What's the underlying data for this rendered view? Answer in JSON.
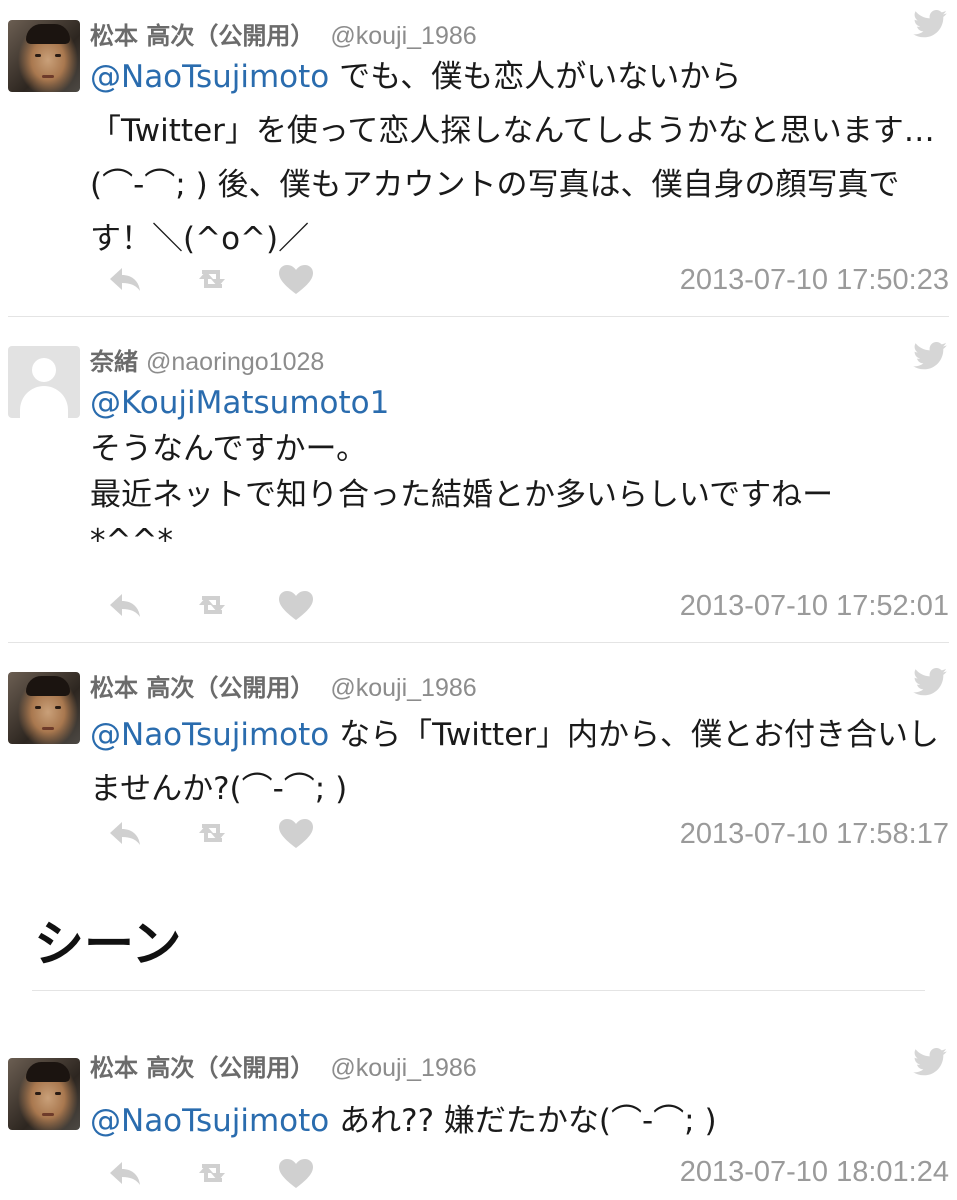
{
  "tweets": [
    {
      "name": "松本 高次（公開用）",
      "handle": "@kouji_1986",
      "mention": "@NaoTsujimoto",
      "body": " でも、僕も恋人がいないから\n「Twitter」を使って恋人探しなんてしようかなと思います…(⌒-⌒; ) 後、僕もアカウントの写真は、僕自身の顔写真です！＼(^o^)／",
      "time": "2013-07-10 17:50:23"
    },
    {
      "name": "奈緒",
      "handle": "@naoringo1028",
      "mention": "@KoujiMatsumoto1",
      "body": "\nそうなんですかー。\n最近ネットで知り合った結婚とか多いらしいですねー\n*^^*",
      "time": "2013-07-10 17:52:01"
    },
    {
      "name": "松本 高次（公開用）",
      "handle": "@kouji_1986",
      "mention": "@NaoTsujimoto",
      "body": " なら「Twitter」内から、僕とお付き合いしませんか?(⌒-⌒; )",
      "time": "2013-07-10 17:58:17"
    },
    {
      "name": "松本 高次（公開用）",
      "handle": "@kouji_1986",
      "mention": "@NaoTsujimoto",
      "body": " あれ?? 嫌だたかな(⌒-⌒; )",
      "time": "2013-07-10 18:01:24"
    }
  ],
  "scene_caption": "シーン",
  "icons": {
    "reply": "reply-icon",
    "retweet": "retweet-icon",
    "like": "heart-icon",
    "logo": "twitter-bird-icon"
  },
  "colors": {
    "mention": "#2a6cae",
    "meta": "#9a9a9a",
    "icon": "#d0d0d0"
  }
}
